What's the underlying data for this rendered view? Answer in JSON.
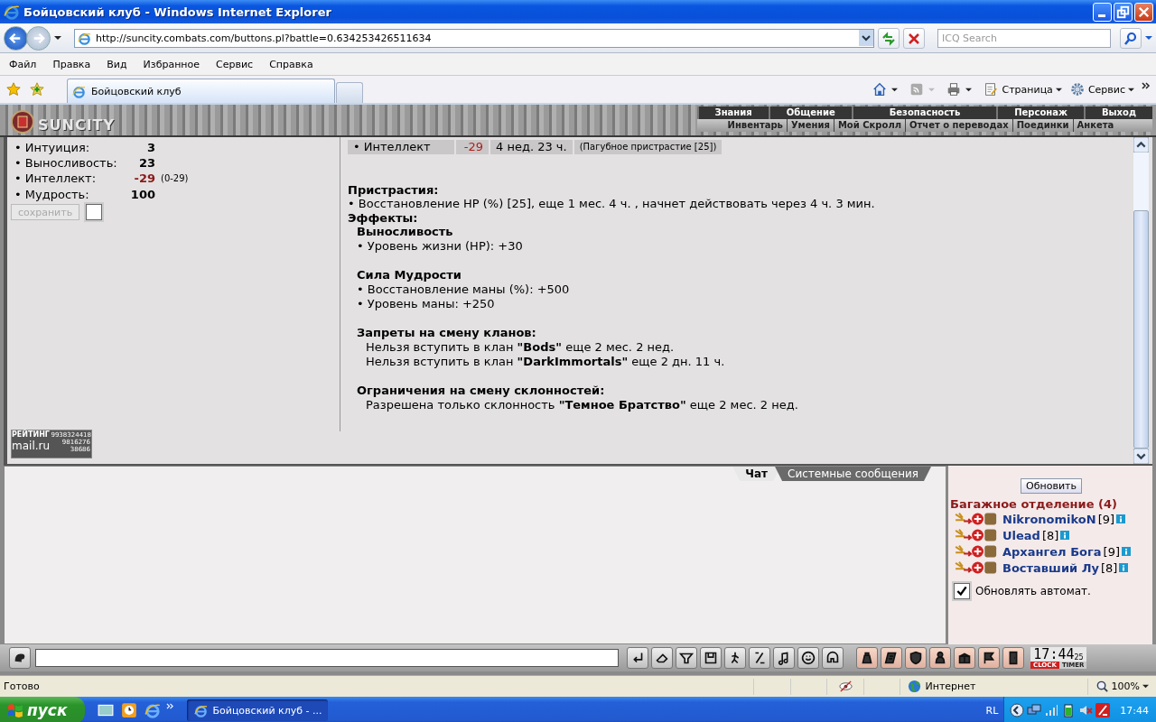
{
  "window": {
    "title": "Бойцовский клуб - Windows Internet Explorer"
  },
  "address_bar": {
    "url": "http://suncity.combats.com/buttons.pl?battle=0.634253426511634"
  },
  "search": {
    "placeholder": "ICQ Search"
  },
  "menu": [
    "Файл",
    "Правка",
    "Вид",
    "Избранное",
    "Сервис",
    "Справка"
  ],
  "tabs": [
    {
      "label": "Бойцовский клуб",
      "selected": true
    }
  ],
  "command_bar": [
    "Страница",
    "Сервис"
  ],
  "game": {
    "logo": "SUNCITY",
    "nav_top": [
      "Знания",
      "Общение",
      "Безопасность",
      "Персонаж",
      "Выход"
    ],
    "nav_sub": [
      "Инвентарь",
      "Умения",
      "Мой Скролл",
      "Отчет о переводах",
      "Поединки",
      "Анкета"
    ],
    "stats": [
      {
        "label": "• Интуиция:",
        "value": "3",
        "color": "#000000"
      },
      {
        "label": "• Выносливость:",
        "value": "23",
        "color": "#000000"
      },
      {
        "label": "• Интеллект:",
        "value": "-29",
        "color": "#8b1a1a",
        "range": "(0-29)"
      },
      {
        "label": "• Мудрость:",
        "value": "100",
        "color": "#000000"
      }
    ],
    "save_button": {
      "label": "сохранить",
      "disabled": true
    },
    "save_checkbox": {
      "checked": false
    },
    "counter": {
      "title": "РЕЙТИНГ",
      "count_1": "9938324418",
      "logo": "mail.ru",
      "count_2": "9816276",
      "count_3": "38686"
    },
    "effect_row": {
      "name": "• Интеллект",
      "value": "-29",
      "duration": "4 нед. 23 ч.",
      "source": "(Пагубное пристрастие [25])"
    },
    "addictions": {
      "title": "Пристрастия:",
      "items": [
        "• Восстановление HP (%) [25], еще 1 мес. 4 ч. , начнет действовать через 4 ч. 3 мин."
      ]
    },
    "effects": {
      "title": "Эффекты:",
      "groups": [
        {
          "title": "Выносливость",
          "lines": [
            {
              "kind": "bullet",
              "text": "• Уровень жизни (HP): +30"
            }
          ]
        },
        {
          "title": "Сила Мудрости",
          "lines": [
            {
              "kind": "bullet",
              "text": "• Восстановление маны (%): +500"
            },
            {
              "kind": "bullet",
              "text": "• Уровень маны: +250"
            }
          ]
        },
        {
          "title": "Запреты на смену кланов:",
          "lines": [
            {
              "kind": "plain",
              "text": "Нельзя вступить в клан **\"Bods\"** еще 2 мес. 2 нед."
            },
            {
              "kind": "plain",
              "text": "Нельзя вступить в клан **\"DarkImmortals\"** еще 2 дн. 11 ч."
            }
          ]
        },
        {
          "title": "Ограничения на смену склонностей:",
          "lines": [
            {
              "kind": "plain",
              "text": "Разрешена только склонность **\"Темное Братство\"** еще 2 мес. 2 нед."
            }
          ]
        }
      ]
    }
  },
  "chat": {
    "tabs": [
      {
        "label": "Чат",
        "selected": true
      },
      {
        "label": "Системные сообщения",
        "selected": false
      }
    ]
  },
  "room": {
    "refresh_button": "Обновить",
    "title": "Багажное отделение (4)",
    "users": [
      {
        "name": "NikronomikoN",
        "level": "[9]"
      },
      {
        "name": "Ulead",
        "level": "[8]"
      },
      {
        "name": "Архангел Бога",
        "level": "[9]"
      },
      {
        "name": "Воставший Лу",
        "level": "[8]"
      }
    ],
    "auto_refresh": {
      "label": "Обновлять автомат.",
      "checked": true
    }
  },
  "clock": {
    "time": "17:44",
    "seconds": "25",
    "clock_label": "CLOCK",
    "timer_label": "TIMER"
  },
  "status_bar": {
    "text": "Готово",
    "zone": "Интернет",
    "zoom": "100%"
  },
  "taskbar": {
    "start": "пуск",
    "tasks": [
      {
        "label": "Бойцовский клуб - ...",
        "selected": true
      }
    ],
    "language": "RL",
    "time": "17:44"
  }
}
